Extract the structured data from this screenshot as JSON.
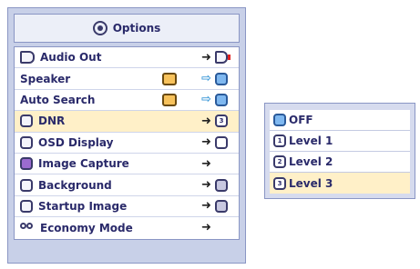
{
  "panel": {
    "title": "Options",
    "title_icon": "options-icon"
  },
  "menu": {
    "items": [
      {
        "label": "Audio Out",
        "left_icon": "speaker-icon",
        "right_icon": "speaker-muted-icon"
      },
      {
        "label": "Speaker",
        "left_icon": "",
        "right_icon": "checkbox-icon"
      },
      {
        "label": "Auto Search",
        "left_icon": "",
        "right_icon": "checkbox-icon"
      },
      {
        "label": "DNR",
        "left_icon": "dnr-icon",
        "right_icon": "dnr-level-icon"
      },
      {
        "label": "OSD Display",
        "left_icon": "osd-icon",
        "right_icon": "osd-icon"
      },
      {
        "label": "Image Capture",
        "left_icon": "capture-icon",
        "right_icon": ""
      },
      {
        "label": "Background",
        "left_icon": "background-icon",
        "right_icon": "background-icon"
      },
      {
        "label": "Startup Image",
        "left_icon": "startup-icon",
        "right_icon": "startup-icon"
      },
      {
        "label": "Economy Mode",
        "left_icon": "economy-icon",
        "right_icon": ""
      }
    ],
    "selected": "DNR"
  },
  "submenu": {
    "items": [
      {
        "label": "OFF",
        "icon": "off-icon"
      },
      {
        "label": "Level 1",
        "icon": "level-1-icon"
      },
      {
        "label": "Level 2",
        "icon": "level-2-icon"
      },
      {
        "label": "Level 3",
        "icon": "level-3-icon"
      }
    ],
    "selected": "Level 3"
  },
  "colors": {
    "highlight": "#fff0c8",
    "panel": "#c8d0e8",
    "accent_blue": "#3f9ad8"
  }
}
